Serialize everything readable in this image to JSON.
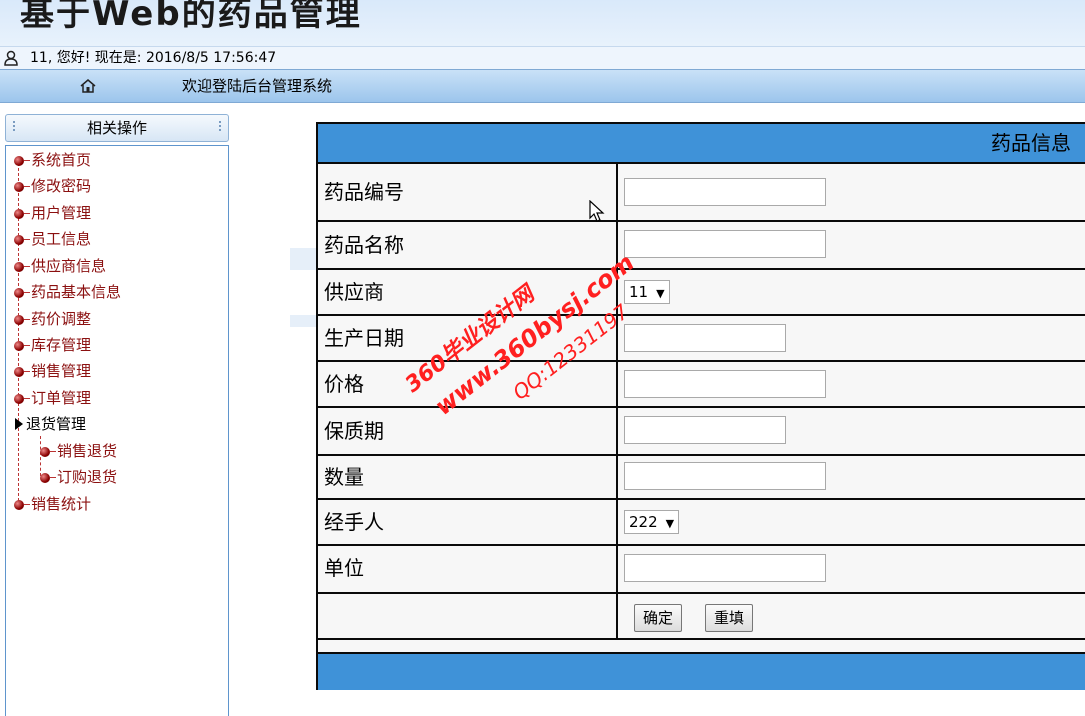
{
  "app": {
    "title": "基于Web的药品管理"
  },
  "status": {
    "greeting": "11, 您好! 现在是: 2016/8/5 17:56:47"
  },
  "nav": {
    "welcome": "欢迎登陆后台管理系统",
    "home_icon": "home-icon"
  },
  "sidebar": {
    "header": "相关操作",
    "items": [
      {
        "label": "系统首页"
      },
      {
        "label": "修改密码"
      },
      {
        "label": "用户管理"
      },
      {
        "label": "员工信息"
      },
      {
        "label": "供应商信息"
      },
      {
        "label": "药品基本信息"
      },
      {
        "label": "药价调整"
      },
      {
        "label": "库存管理"
      },
      {
        "label": "销售管理"
      },
      {
        "label": "订单管理"
      },
      {
        "label": "退货管理",
        "expanded": true
      },
      {
        "label": "销售退货",
        "sub": true
      },
      {
        "label": "订购退货",
        "sub": true
      },
      {
        "label": "销售统计"
      }
    ]
  },
  "form": {
    "caption": "药品信息",
    "fields": [
      {
        "label": "药品编号",
        "type": "text",
        "value": ""
      },
      {
        "label": "药品名称",
        "type": "text",
        "value": ""
      },
      {
        "label": "供应商",
        "type": "select",
        "value": "11"
      },
      {
        "label": "生产日期",
        "type": "text",
        "value": ""
      },
      {
        "label": "价格",
        "type": "text",
        "value": ""
      },
      {
        "label": "保质期",
        "type": "text",
        "value": ""
      },
      {
        "label": "数量",
        "type": "text",
        "value": ""
      },
      {
        "label": "经手人",
        "type": "select",
        "value": "222"
      },
      {
        "label": "单位",
        "type": "text",
        "value": ""
      }
    ],
    "submit_label": "确定",
    "reset_label": "重填"
  },
  "watermark": {
    "line1": "360毕业设计网",
    "line2": "www.360bysj.com",
    "line3": "QQ:12331197"
  },
  "colors": {
    "accent": "#3f92d8",
    "menu_text": "#8b1010",
    "watermark": "#ff2020"
  }
}
